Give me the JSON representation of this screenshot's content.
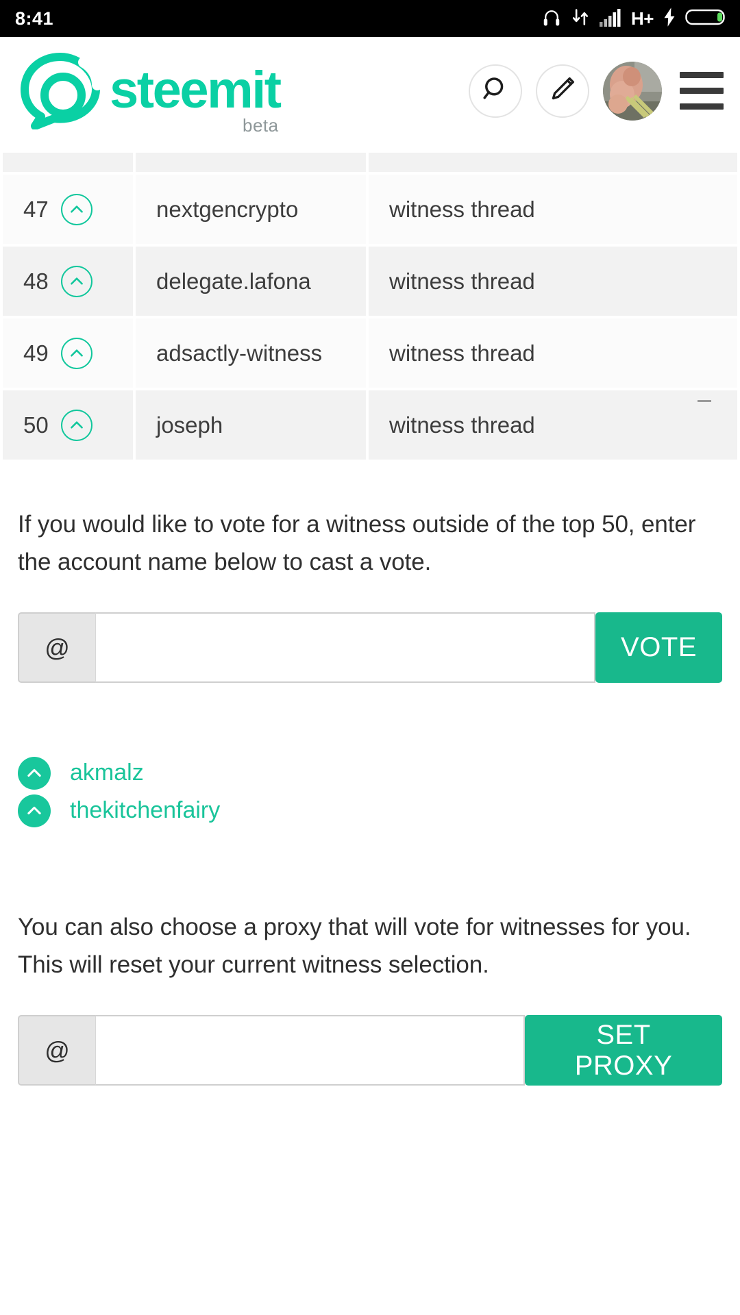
{
  "status_bar": {
    "time": "8:41",
    "network_label": "H+",
    "icons": [
      "headphones-icon",
      "data-transfer-icon",
      "signal-bars-icon",
      "charging-bolt-icon",
      "battery-icon"
    ]
  },
  "header": {
    "brand_name": "steemit",
    "brand_tag": "beta",
    "brand_color": "#0ad0a4",
    "actions": [
      {
        "name": "search-button",
        "icon": "search-icon"
      },
      {
        "name": "compose-button",
        "icon": "pencil-icon"
      },
      {
        "name": "avatar-button",
        "icon": "avatar"
      },
      {
        "name": "menu-button",
        "icon": "hamburger-icon"
      }
    ]
  },
  "witness_table": {
    "columns": [
      "rank",
      "account",
      "link"
    ],
    "rows": [
      {
        "rank": "47",
        "account": "nextgencrypto",
        "link": "witness thread",
        "shade": "light"
      },
      {
        "rank": "48",
        "account": "delegate.lafona",
        "link": "witness thread",
        "shade": "dark"
      },
      {
        "rank": "49",
        "account": "adsactly-witness",
        "link": "witness thread",
        "shade": "light"
      },
      {
        "rank": "50",
        "account": "joseph",
        "link": "witness thread",
        "shade": "dark"
      }
    ]
  },
  "vote_section": {
    "description": "If you would like to vote for a witness outside of the top 50, enter the account name below to cast a vote.",
    "prefix": "@",
    "input_value": "",
    "input_placeholder": "",
    "button_label": "VOTE"
  },
  "voted_witnesses": [
    {
      "name": "akmalz"
    },
    {
      "name": "thekitchenfairy"
    }
  ],
  "proxy_section": {
    "description": "You can also choose a proxy that will vote for witnesses for you. This will reset your current witness selection.",
    "prefix": "@",
    "input_value": "",
    "input_placeholder": "",
    "button_label": "SET PROXY"
  },
  "colors": {
    "accent": "#18c79c",
    "accent_button": "#18b88c",
    "brand": "#0ad0a4",
    "row_light": "#fbfbfb",
    "row_dark": "#f2f2f2"
  }
}
